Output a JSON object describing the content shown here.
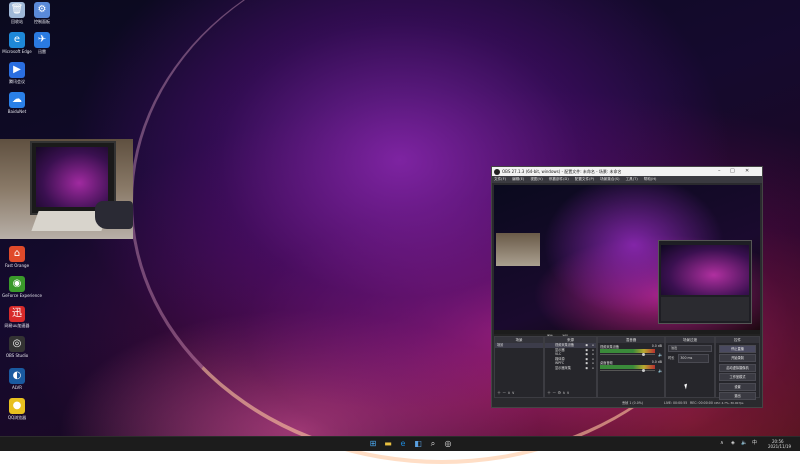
{
  "desktop": {
    "icons": [
      {
        "label": "回收站",
        "icon": "recycle-bin-icon",
        "color": "#9fb8d8",
        "glyph": "🗑"
      },
      {
        "label": "控制面板",
        "icon": "control-panel-icon",
        "color": "#5a8ad8",
        "glyph": "⚙"
      },
      {
        "label": "Microsoft Edge",
        "icon": "edge-icon",
        "color": "#1e88d8",
        "glyph": "e"
      },
      {
        "label": "迅雷",
        "icon": "thunder-icon",
        "color": "#2a7ae0",
        "glyph": "✈"
      },
      {
        "label": "腾讯会议",
        "icon": "meeting-icon",
        "color": "#2a6ee0",
        "glyph": "▶"
      },
      {
        "label": "BaiduNet",
        "icon": "baidu-netdisk-icon",
        "color": "#2a80e8",
        "glyph": "☁"
      },
      {
        "label": "Fast Orange",
        "icon": "fast-orange-icon",
        "color": "#e04a2a",
        "glyph": "⌂"
      },
      {
        "label": "GeForce Experience",
        "icon": "nvidia-icon",
        "color": "#3a9a2a",
        "glyph": "◉"
      },
      {
        "label": "网易uu加速器",
        "icon": "uu-accelerator-icon",
        "color": "#d82a2a",
        "glyph": "迅"
      },
      {
        "label": "OBS Studio",
        "icon": "obs-icon",
        "color": "#333333",
        "glyph": "◎"
      },
      {
        "label": "ALVR",
        "icon": "alvr-icon",
        "color": "#1a5aa0",
        "glyph": "◐"
      },
      {
        "label": "QQ浏览器",
        "icon": "qq-browser-icon",
        "color": "#e8c020",
        "glyph": "●"
      }
    ]
  },
  "obs": {
    "title": "OBS 27.1.3 (64-bit, windows) - 配置文件: 未命名 - 场景: 未命名",
    "menu": [
      "文件(F)",
      "编辑(E)",
      "视图(V)",
      "停靠部件(D)",
      "配置文件(P)",
      "场景集合(S)",
      "工具(T)",
      "帮助(H)"
    ],
    "toolbar": {
      "properties": "属性",
      "filters": "滤镜"
    },
    "panels": {
      "scenes": {
        "title": "场景",
        "items": [
          "场景"
        ]
      },
      "sources": {
        "title": "来源",
        "items": [
          "视频采集设备",
          "显示器",
          "VLC",
          "媒体源",
          "WPFC",
          "显示器采集"
        ]
      },
      "mixer": {
        "title": "混音器",
        "channels": [
          {
            "name": "视频采集设备",
            "db": "0.0 dB"
          },
          {
            "name": "桌面音频",
            "db": "0.0 dB"
          }
        ]
      },
      "transitions": {
        "title": "场景过渡",
        "type": "淡出",
        "duration_label": "时长",
        "duration": "300 ms"
      },
      "controls": {
        "title": "控件",
        "buttons": [
          "停止直播",
          "开始录制",
          "启动虚拟摄像机",
          "工作室模式",
          "设置",
          "退出"
        ]
      }
    },
    "status": {
      "dropped": "丢帧 1 (0.0%)",
      "live": "LIVE: 00:00:55",
      "rec": "REC: 00:00:00",
      "cpu": "CPU: 4.7%, 30.00 fps",
      "kbps": "kb/s: 2460"
    }
  },
  "taskbar": {
    "pinned": [
      {
        "icon": "windows-start-icon",
        "glyph": "⊞",
        "color": "#4aa8f0"
      },
      {
        "icon": "file-explorer-icon",
        "glyph": "▬",
        "color": "#e8c040"
      },
      {
        "icon": "edge-icon",
        "glyph": "e",
        "color": "#1e88d8"
      },
      {
        "icon": "store-icon",
        "glyph": "◧",
        "color": "#5aa0e0"
      },
      {
        "icon": "search-icon",
        "glyph": "⌕",
        "color": "#e0e0e0"
      },
      {
        "icon": "obs-icon",
        "glyph": "◎",
        "color": "#e0e0e0"
      }
    ],
    "tray": {
      "lang": "中",
      "time": "20:56",
      "date": "2021/11/19"
    }
  }
}
